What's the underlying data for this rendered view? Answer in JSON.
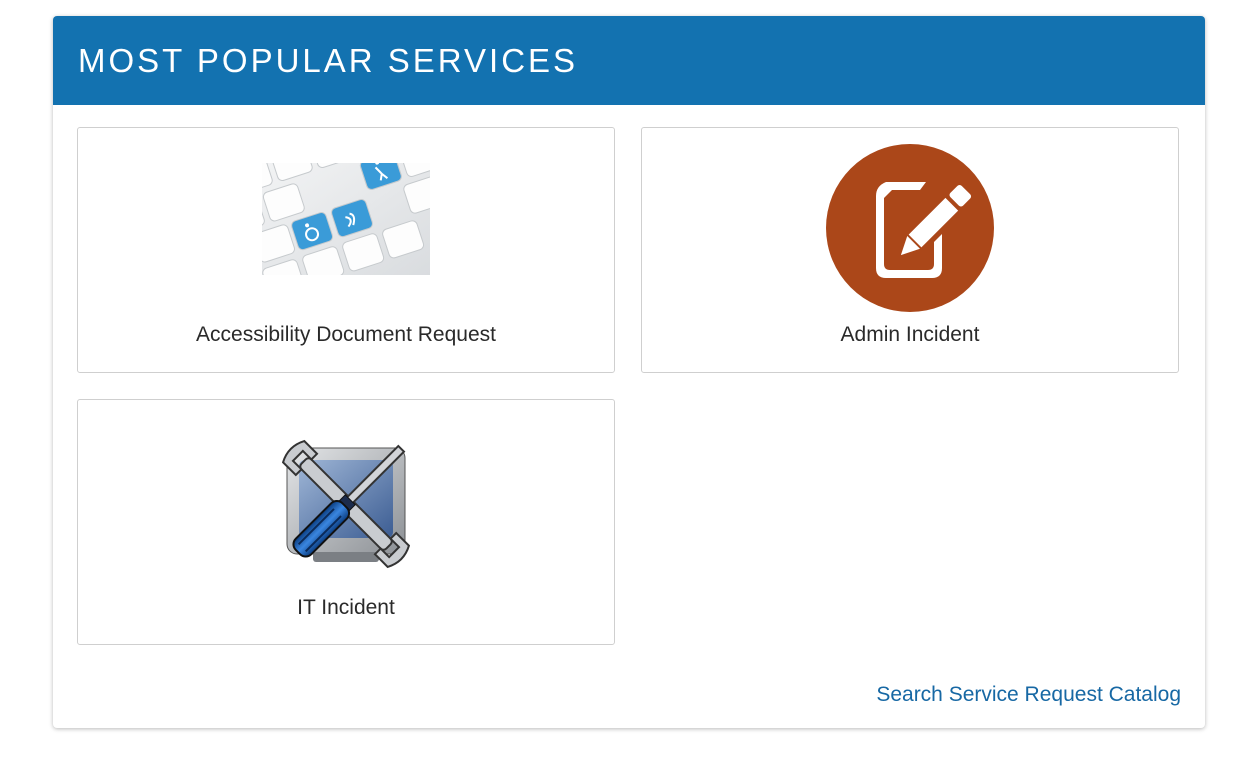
{
  "header": {
    "title": "MOST POPULAR SERVICES"
  },
  "services": [
    {
      "label": "Accessibility Document Request",
      "icon": "accessibility-keyboard-icon"
    },
    {
      "label": "Admin Incident",
      "icon": "edit-document-icon"
    },
    {
      "label": "IT Incident",
      "icon": "tools-monitor-icon"
    }
  ],
  "footer": {
    "link_label": "Search Service Request Catalog"
  },
  "colors": {
    "header_bg": "#1372b0",
    "link": "#1768a4",
    "admin_icon_bg": "#ab4719",
    "accessibility_key": "#3a9bd8"
  }
}
